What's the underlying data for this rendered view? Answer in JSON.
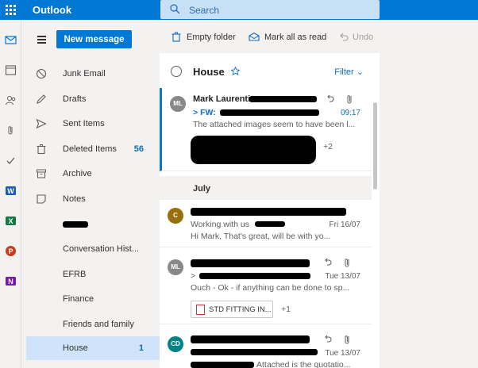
{
  "app": {
    "title": "Outlook"
  },
  "search": {
    "placeholder": "Search"
  },
  "colors": {
    "accent": "#0078d4",
    "selected_folder": "#cfe4fa"
  },
  "compose": {
    "label": "New message"
  },
  "folders": [
    {
      "label": "Junk Email",
      "icon": "block-icon",
      "count": ""
    },
    {
      "label": "Drafts",
      "icon": "pencil-icon",
      "count": ""
    },
    {
      "label": "Sent Items",
      "icon": "send-icon",
      "count": ""
    },
    {
      "label": "Deleted Items",
      "icon": "trash-icon",
      "count": "56"
    },
    {
      "label": "Archive",
      "icon": "archive-icon",
      "count": ""
    },
    {
      "label": "Notes",
      "icon": "note-icon",
      "count": ""
    },
    {
      "label": "",
      "icon": "",
      "count": ""
    },
    {
      "label": "Conversation Hist...",
      "icon": "",
      "count": ""
    },
    {
      "label": "EFRB",
      "icon": "",
      "count": ""
    },
    {
      "label": "Finance",
      "icon": "",
      "count": ""
    },
    {
      "label": "Friends and family",
      "icon": "",
      "count": ""
    },
    {
      "label": "House",
      "icon": "",
      "count": "1"
    }
  ],
  "toolbar": {
    "empty_folder": "Empty folder",
    "mark_all_read": "Mark all as read",
    "undo": "Undo"
  },
  "list": {
    "title": "House",
    "filter": "Filter",
    "group_label": "July",
    "messages": [
      {
        "initials": "ML",
        "avatar_color": "#8a8886",
        "sender": "Mark Laurenti:",
        "subject_prefix": "FW:",
        "time": "09:17",
        "preview": "The attached images seem to have been l...",
        "extra": "+2"
      },
      {
        "initials": "C",
        "avatar_color": "#986f0b",
        "sender": "",
        "subject_prefix": "Working with us",
        "time": "Fri 16/07",
        "preview": "Hi Mark, That's great, will be with yo...",
        "extra": ""
      },
      {
        "initials": "ML",
        "avatar_color": "#8a8886",
        "sender": "",
        "subject_prefix": ">",
        "time": "Tue 13/07",
        "preview": "Ouch - Ok - if anything can be done to sp...",
        "attachment": "STD FITTING IN...",
        "extra": "+1"
      },
      {
        "initials": "CD",
        "avatar_color": "#038387",
        "sender": "",
        "subject_prefix": "",
        "time": "Tue 13/07",
        "preview": "Attached is the quotatio..."
      }
    ]
  }
}
